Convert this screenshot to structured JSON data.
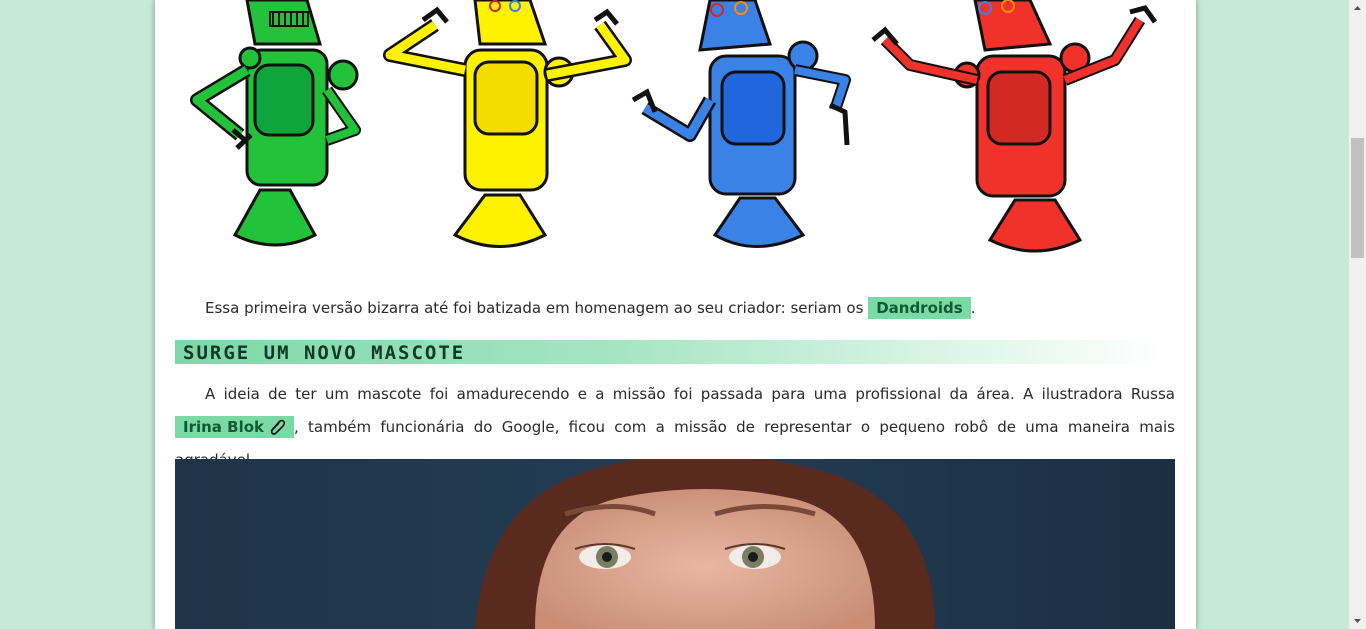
{
  "article": {
    "intro": {
      "text": "Essa primeira versão bizarra até foi batizada em homenagem ao seu criador: seriam os",
      "highlight": "Dandroids",
      "after": "."
    },
    "heading": "SURGE UM NOVO MASCOTE",
    "second": {
      "text": "A ideia de ter um mascote foi amadurecendo e a missão foi passada para uma profissional da área. A ilustradora Russa",
      "highlight": "Irina Blok",
      "after": ", também funcionária do Google, ficou com a missão de representar o pequeno robô de uma maneira mais agradável."
    }
  },
  "robots": [
    {
      "name": "green-robot",
      "color": "#22c33a",
      "dark": "#0ea53c"
    },
    {
      "name": "yellow-robot",
      "color": "#fff200",
      "dark": "#f4dc00"
    },
    {
      "name": "blue-robot",
      "color": "#3b82e6",
      "dark": "#2266dd"
    },
    {
      "name": "red-robot",
      "color": "#f0322a",
      "dark": "#d22a22"
    }
  ],
  "colors": {
    "background": "#c5ead8",
    "highlight": "#7ad9a4",
    "highlight_text": "#0e5a33"
  },
  "icons": {
    "link": "paperclip-icon"
  }
}
